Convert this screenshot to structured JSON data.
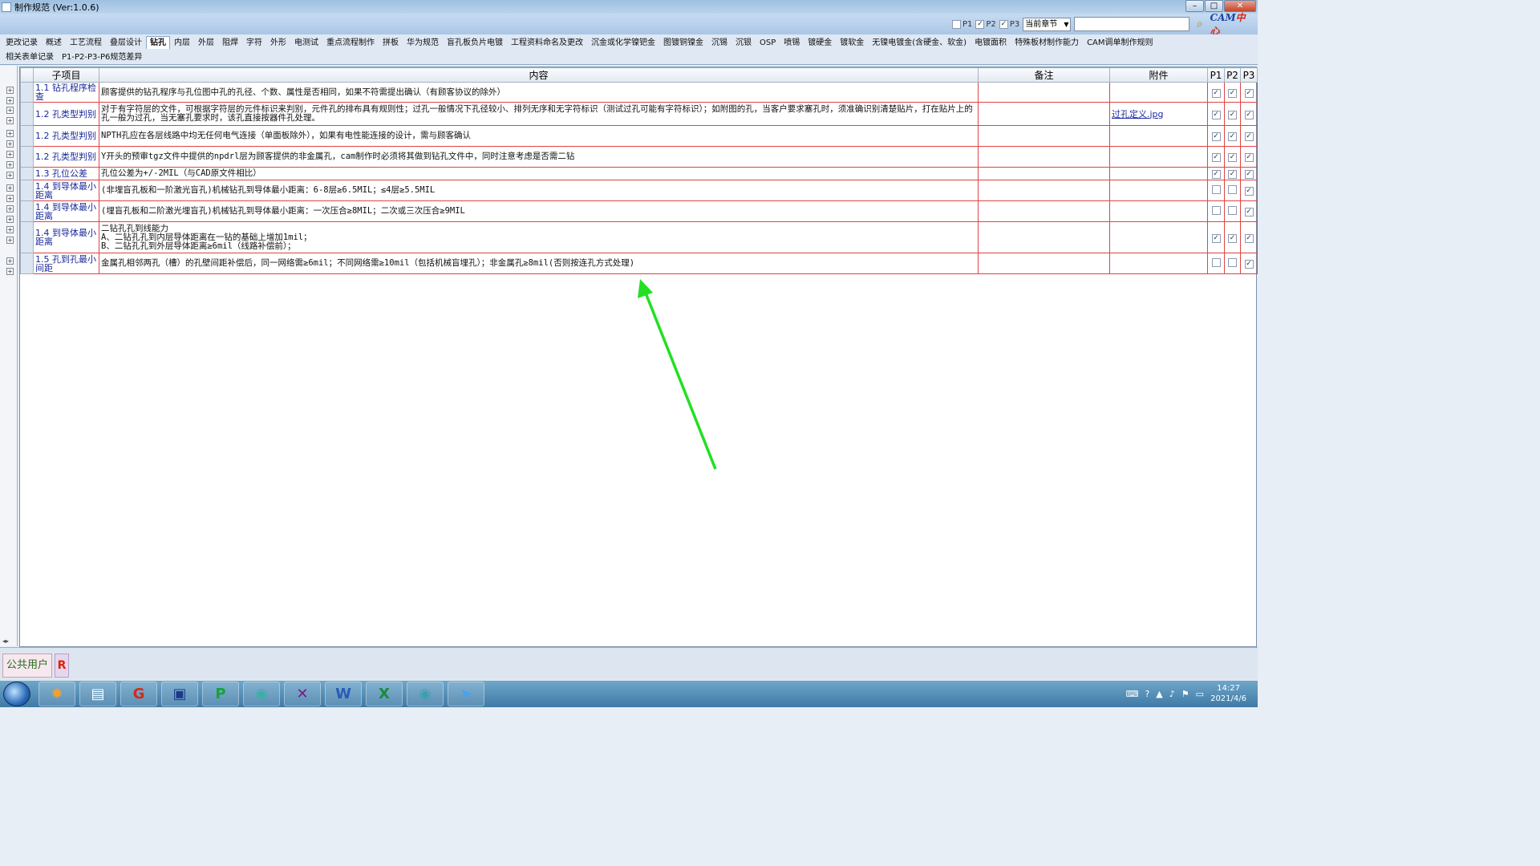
{
  "window": {
    "title": "制作规范 (Ver:1.0.6)"
  },
  "filter": {
    "checks": [
      {
        "label": "P1",
        "checked": false
      },
      {
        "label": "P2",
        "checked": true
      },
      {
        "label": "P3",
        "checked": true
      }
    ],
    "scope_select": "当前章节",
    "logo_main": "CAM",
    "logo_accent": "中心"
  },
  "tabs_row1": [
    "更改记录",
    "概述",
    "工艺流程",
    "叠层设计",
    "钻孔",
    "内层",
    "外层",
    "阻焊",
    "字符",
    "外形",
    "电测试",
    "重点流程制作",
    "拼板",
    "华为规范",
    "盲孔板负片电镀",
    "工程资料命名及更改",
    "沉金或化学镍钯金",
    "图镀铜镍金",
    "沉锡",
    "沉银",
    "OSP",
    "喷锡",
    "镀硬金",
    "镀软金",
    "无镍电镀金(含硬金、软金)",
    "电镀面积",
    "特殊板材制作能力",
    "CAM调单制作规则"
  ],
  "tabs_row2": [
    "相关表单记录",
    "P1-P2-P3-P6规范差异"
  ],
  "active_tab": "钻孔",
  "grid": {
    "headers": {
      "sub": "子项目",
      "content": "内容",
      "note": "备注",
      "attach": "附件",
      "p1": "P1",
      "p2": "P2",
      "p3": "P3"
    },
    "rows": [
      {
        "sub": "1.1 钻孔程序检查",
        "content": "顾客提供的钻孔程序与孔位图中孔的孔径、个数、属性是否相同，如果不符需提出确认（有顾客协议的除外）",
        "note": "",
        "attach": "",
        "p1": true,
        "p2": true,
        "p3": true
      },
      {
        "sub": "1.2 孔类型判别",
        "content": "对于有字符层的文件，可根据字符层的元件标识来判别，元件孔的排布具有规则性；过孔一般情况下孔径较小、排列无序和无字符标识（测试过孔可能有字符标识）；如附图的孔，当客户要求塞孔时，须准确识别清楚贴片，打在贴片上的孔一般为过孔，当无塞孔要求时，该孔直接按器件孔处理。",
        "note": "",
        "attach": "过孔定义.jpg",
        "p1": true,
        "p2": true,
        "p3": true
      },
      {
        "sub": "1.2 孔类型判别",
        "content": "NPTH孔应在各层线路中均无任何电气连接（单面板除外），如果有电性能连接的设计，需与顾客确认",
        "note": "",
        "attach": "",
        "p1": true,
        "p2": true,
        "p3": true
      },
      {
        "sub": "1.2 孔类型判别",
        "content": "Y开头的预审tgz文件中提供的npdrl层为顾客提供的非金属孔，cam制作时必须将其做到钻孔文件中，同时注意考虑是否需二钻",
        "note": "",
        "attach": "",
        "p1": true,
        "p2": true,
        "p3": true
      },
      {
        "sub": "1.3 孔位公差",
        "content": "孔位公差为+/-2MIL（与CAD原文件相比）",
        "note": "",
        "attach": "",
        "p1": true,
        "p2": true,
        "p3": true
      },
      {
        "sub": "1.4 到导体最小距离",
        "content": "(非埋盲孔板和一阶激光盲孔)机械钻孔到导体最小距离：6-8层≥6.5MIL；≤4层≥5.5MIL",
        "note": "",
        "attach": "",
        "p1": false,
        "p2": false,
        "p3": true
      },
      {
        "sub": "1.4 到导体最小距离",
        "content": "(埋盲孔板和二阶激光埋盲孔)机械钻孔到导体最小距离：一次压合≥8MIL；二次或三次压合≥9MIL",
        "note": "",
        "attach": "",
        "p1": false,
        "p2": false,
        "p3": true
      },
      {
        "sub": "1.4 到导体最小距离",
        "content": " 二钻孔孔到线能力\nA、二钻孔孔到内层导体距离在一钻的基础上增加1mil；\nB、二钻孔孔到外层导体距离≥6mil（线路补偿前）；",
        "note": "",
        "attach": "",
        "p1": true,
        "p2": true,
        "p3": true
      },
      {
        "sub": "1.5 孔到孔最小间距",
        "content": "金属孔相邻两孔（槽）的孔壁间距补偿后，同一网络需≥6mil；不同网络需≥10mil（包括机械盲埋孔）；非金属孔≥8mil(否则按连孔方式处理)",
        "note": "",
        "attach": "",
        "p1": false,
        "p2": false,
        "p3": true
      }
    ]
  },
  "status": {
    "user": "公共用户",
    "role": "R"
  },
  "taskbar": {
    "apps": [
      "burst-app",
      "notepad-app",
      "g-app",
      "save-app",
      "p-app",
      "eye-app",
      "x-app",
      "word-app",
      "excel-app",
      "eye2-app",
      "bird-app"
    ],
    "time": "14:27",
    "date": "2021/4/6"
  },
  "colors": {
    "row_border": "#dd4444",
    "annotation_arrow": "#22e022",
    "active_tab_bg": "#ffffff"
  }
}
